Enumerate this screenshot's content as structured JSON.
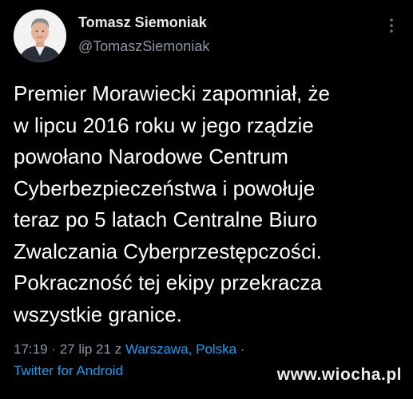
{
  "author": {
    "display_name": "Tomasz Siemoniak",
    "handle": "@TomaszSiemoniak"
  },
  "icons": {
    "avatar": "profile-photo",
    "more": "vertical-ellipsis-icon"
  },
  "tweet": {
    "lines": [
      "Premier Morawiecki zapomniał, że",
      "w lipcu 2016 roku w jego rządzie",
      "powołano Narodowe Centrum",
      "Cyberbezpieczeństwa i powołuje",
      "teraz po 5 latach Centralne Biuro",
      "Zwalczania Cyberprzestępczości.",
      "Pokraczność tej ekipy przekracza",
      "wszystkie granice."
    ],
    "time": "17:19",
    "separator1": "·",
    "date": "27 lip 21",
    "from_word": "z",
    "location": "Warszawa, Polska",
    "separator2": "·",
    "source": "Twitter for Android"
  },
  "watermark": "www.wiocha.pl",
  "colors": {
    "background": "#000000",
    "text": "#ffffff",
    "secondary": "#8b98a5",
    "link": "#1d9bf0"
  }
}
